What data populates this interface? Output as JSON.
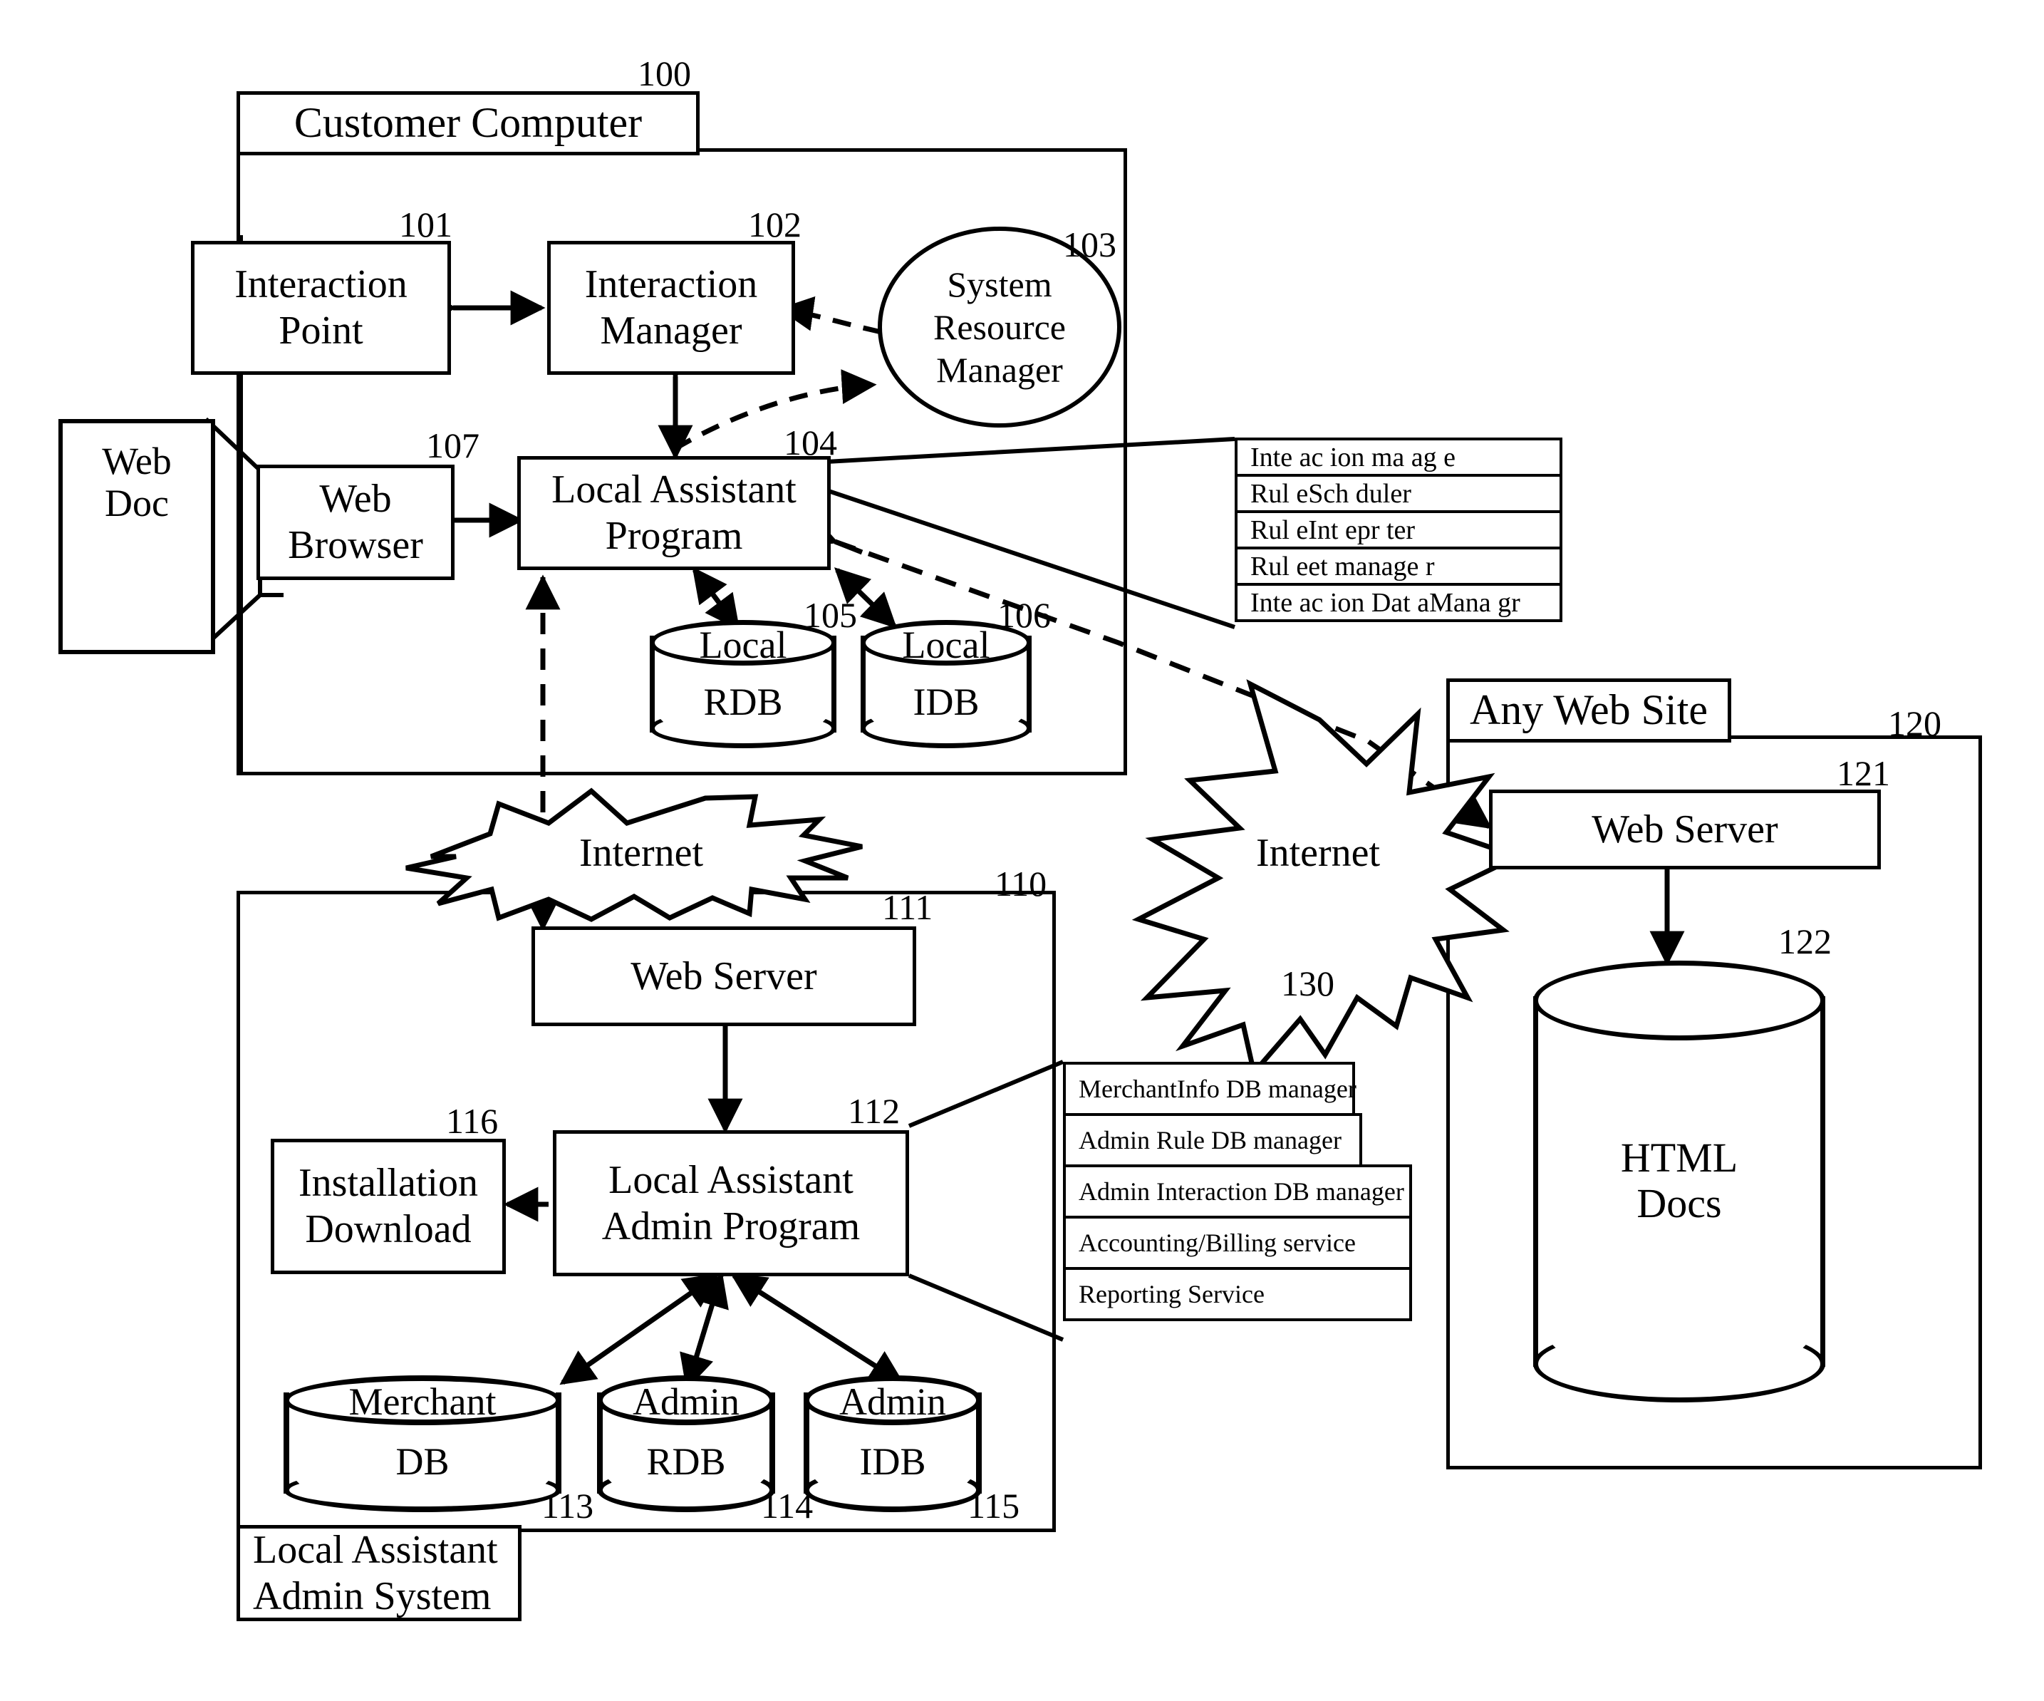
{
  "figure": {
    "customer_computer": {
      "title": "Customer Computer",
      "ref": "100",
      "interaction_point": {
        "label": "Interaction\nPoint",
        "line1": "Interaction",
        "line2": "Point",
        "ref": "101"
      },
      "interaction_manager": {
        "line1": "Interaction",
        "line2": "Manager",
        "ref": "102"
      },
      "system_resource_manager": {
        "line1": "System",
        "line2": "Resource",
        "line3": "Manager",
        "ref": "103"
      },
      "local_assistant_program": {
        "line1": "Local Assistant",
        "line2": "Program",
        "ref": "104"
      },
      "web_browser": {
        "line1": "Web",
        "line2": "Browser",
        "ref": "107"
      },
      "local_rdb": {
        "line1": "Local",
        "line2": "RDB",
        "ref": "105"
      },
      "local_idb": {
        "line1": "Local",
        "line2": "IDB",
        "ref": "106"
      }
    },
    "web_doc": {
      "line1": "Web",
      "line2": "Doc"
    },
    "local_assistant_modules": [
      "Inte ac ion ma ag e",
      "Rul eSch duler",
      "Rul eInt epr ter",
      "Rul eet manage r",
      "Inte ac ion Dat aMana gr"
    ],
    "internet_left": {
      "label": "Internet"
    },
    "internet_right": {
      "label": "Internet",
      "ref": "130"
    },
    "admin_system": {
      "title_line1": "Local Assistant",
      "title_line2": "Admin System",
      "ref": "110",
      "web_server": {
        "label": "Web Server",
        "ref": "111"
      },
      "admin_program": {
        "line1": "Local Assistant",
        "line2": "Admin Program",
        "ref": "112"
      },
      "installation_download": {
        "line1": "Installation",
        "line2": "Download",
        "ref": "116"
      },
      "merchant_db": {
        "line1": "Merchant",
        "line2": "DB",
        "ref": "113"
      },
      "admin_rdb": {
        "line1": "Admin",
        "line2": "RDB",
        "ref": "114"
      },
      "admin_idb": {
        "line1": "Admin",
        "line2": "IDB",
        "ref": "115"
      }
    },
    "admin_modules": [
      "MerchantInfo DB manager",
      "Admin Rule DB manager",
      "Admin Interaction DB manager",
      "Accounting/Billing service",
      "Reporting Service"
    ],
    "any_web_site": {
      "title": "Any Web Site",
      "ref": "120",
      "web_server": {
        "label": "Web Server",
        "ref": "121"
      },
      "html_docs": {
        "line1": "HTML",
        "line2": "Docs",
        "ref": "122"
      }
    }
  },
  "colors": {
    "stroke": "#000000",
    "fill": "#ffffff"
  }
}
